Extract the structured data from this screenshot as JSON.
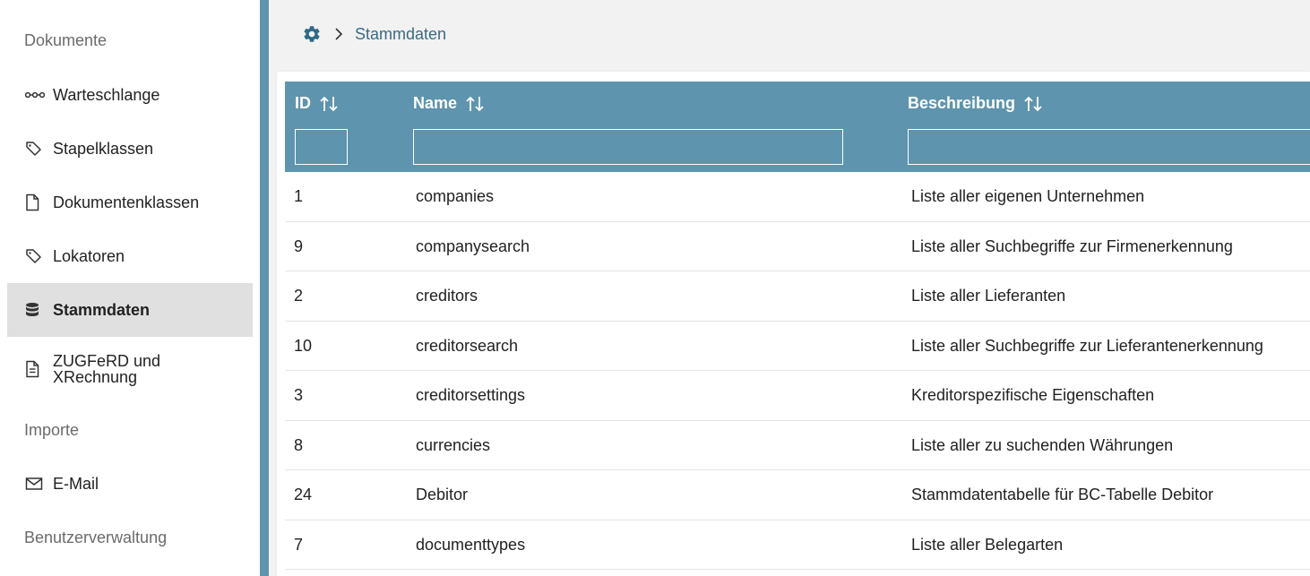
{
  "sidebar": {
    "sections": {
      "dokumente": "Dokumente",
      "importe": "Importe",
      "benutzerverwaltung": "Benutzerverwaltung"
    },
    "items": [
      {
        "label": "Warteschlange",
        "icon": "queue-icon"
      },
      {
        "label": "Stapelklassen",
        "icon": "tag-icon"
      },
      {
        "label": "Dokumentenklassen",
        "icon": "file-icon"
      },
      {
        "label": "Lokatoren",
        "icon": "tag-icon"
      },
      {
        "label": "Stammdaten",
        "icon": "database-icon",
        "active": true
      },
      {
        "label": "ZUGFeRD und XRechnung",
        "icon": "file-text-icon"
      },
      {
        "label": "E-Mail",
        "icon": "mail-icon"
      }
    ]
  },
  "breadcrumb": {
    "icon": "gear-icon",
    "current": "Stammdaten"
  },
  "table": {
    "columns": [
      {
        "label": "ID",
        "sortable": true
      },
      {
        "label": "Name",
        "sortable": true
      },
      {
        "label": "Beschreibung",
        "sortable": true
      }
    ],
    "filters": {
      "id": "",
      "name": "",
      "beschreibung": ""
    },
    "rows": [
      {
        "id": "1",
        "name": "companies",
        "beschreibung": "Liste aller eigenen Unternehmen"
      },
      {
        "id": "9",
        "name": "companysearch",
        "beschreibung": "Liste aller Suchbegriffe zur Firmenerkennung"
      },
      {
        "id": "2",
        "name": "creditors",
        "beschreibung": "Liste aller Lieferanten"
      },
      {
        "id": "10",
        "name": "creditorsearch",
        "beschreibung": "Liste aller Suchbegriffe zur Lieferantenerkennung"
      },
      {
        "id": "3",
        "name": "creditorsettings",
        "beschreibung": "Kreditorspezifische Eigenschaften"
      },
      {
        "id": "8",
        "name": "currencies",
        "beschreibung": "Liste aller zu suchenden Währungen"
      },
      {
        "id": "24",
        "name": "Debitor",
        "beschreibung": "Stammdatentabelle für BC-Tabelle Debitor"
      },
      {
        "id": "7",
        "name": "documenttypes",
        "beschreibung": "Liste aller Belegarten"
      }
    ]
  },
  "colors": {
    "accent": "#5e94ad",
    "active_bg": "#e0e0e0",
    "breadcrumb_text": "#3a6b82"
  }
}
